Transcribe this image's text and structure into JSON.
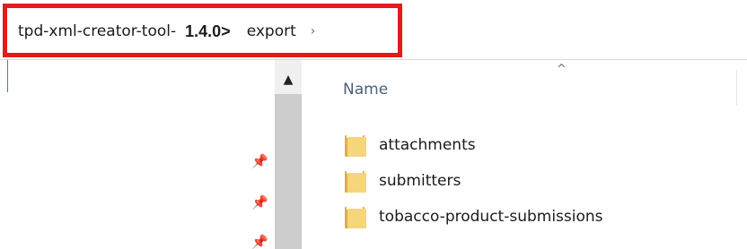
{
  "breadcrumb": {
    "root": "tpd-xml-creator-tool-",
    "version": "1.4.0>",
    "current": "export",
    "separator": "›"
  },
  "icons": {
    "pin": "pin-icon",
    "scroll_up": "chevron-up-icon",
    "sort": "sort-ascending-icon",
    "folder": "folder-icon"
  },
  "colors": {
    "highlight": "#e21c1c",
    "folder_front": "#f6d57d",
    "folder_back": "#dcb04a",
    "header_text": "#4c607a"
  },
  "columns": {
    "name": "Name"
  },
  "files": [
    {
      "name": "attachments",
      "type": "folder"
    },
    {
      "name": "submitters",
      "type": "folder"
    },
    {
      "name": "tobacco-product-submissions",
      "type": "folder"
    }
  ]
}
